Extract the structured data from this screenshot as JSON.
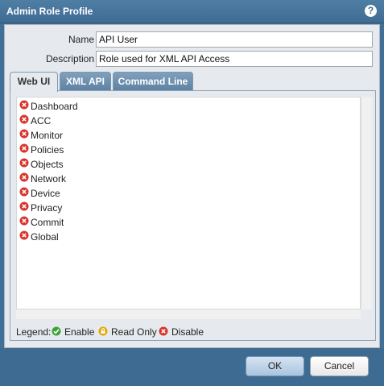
{
  "window": {
    "title": "Admin Role Profile",
    "help_icon": "question-mark-icon"
  },
  "form": {
    "name_label": "Name",
    "name_value": "API User",
    "description_label": "Description",
    "description_value": "Role used for XML API Access"
  },
  "tabs": [
    {
      "label": "Web UI",
      "active": true
    },
    {
      "label": "XML API",
      "active": false
    },
    {
      "label": "Command Line",
      "active": false
    }
  ],
  "permissions": [
    {
      "label": "Dashboard",
      "state": "disable"
    },
    {
      "label": "ACC",
      "state": "disable"
    },
    {
      "label": "Monitor",
      "state": "disable"
    },
    {
      "label": "Policies",
      "state": "disable"
    },
    {
      "label": "Objects",
      "state": "disable"
    },
    {
      "label": "Network",
      "state": "disable"
    },
    {
      "label": "Device",
      "state": "disable"
    },
    {
      "label": "Privacy",
      "state": "disable"
    },
    {
      "label": "Commit",
      "state": "disable"
    },
    {
      "label": "Global",
      "state": "disable"
    }
  ],
  "legend": {
    "title": "Legend:",
    "enable": "Enable",
    "read_only": "Read Only",
    "disable": "Disable"
  },
  "buttons": {
    "ok": "OK",
    "cancel": "Cancel"
  },
  "colors": {
    "enable": "#3aa23a",
    "read_only": "#e0a800",
    "disable": "#d9342b"
  }
}
